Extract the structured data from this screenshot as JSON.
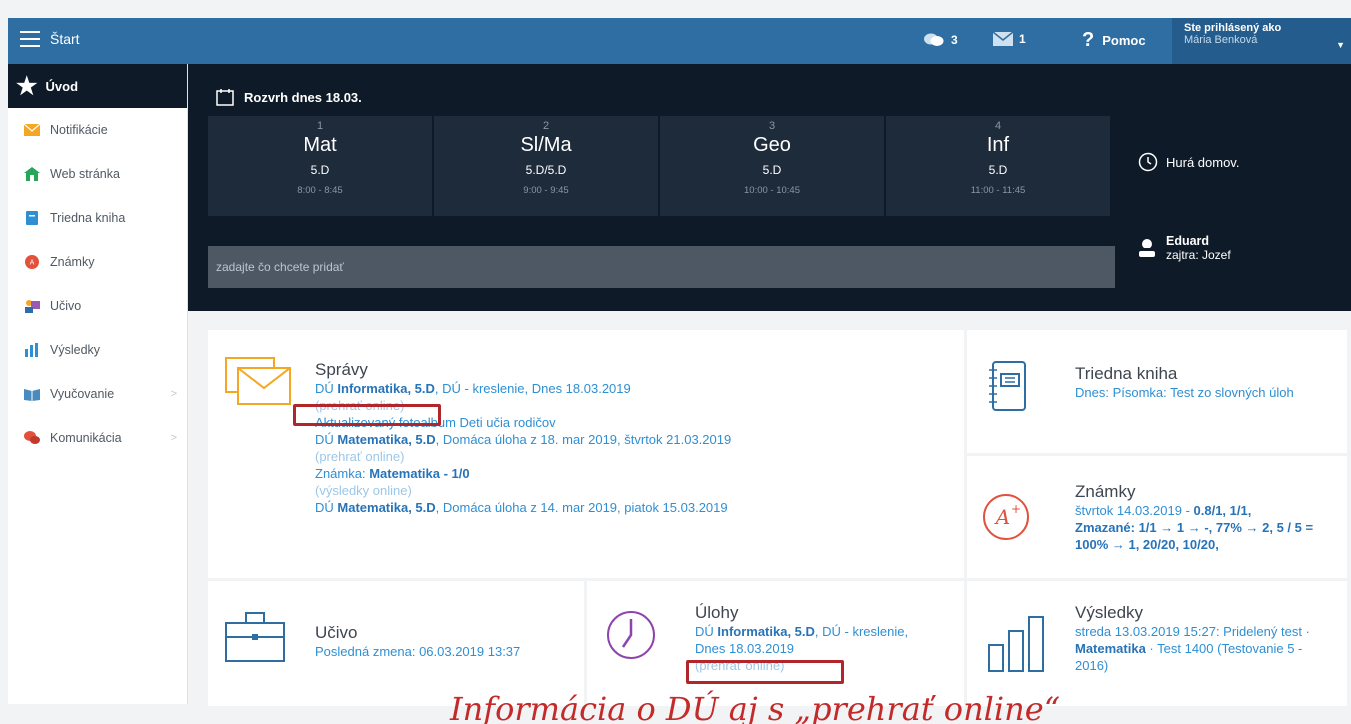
{
  "topbar": {
    "title": "Štart",
    "messages_count": "3",
    "mail_count": "1",
    "help_label": "Pomoc",
    "user_label": "Ste prihlásený ako",
    "user_name": "Mária Benková"
  },
  "sidebar": {
    "items": [
      {
        "label": "Úvod"
      },
      {
        "label": "Notifikácie"
      },
      {
        "label": "Web stránka"
      },
      {
        "label": "Triedna kniha"
      },
      {
        "label": "Známky"
      },
      {
        "label": "Učivo"
      },
      {
        "label": "Výsledky"
      },
      {
        "label": "Vyučovanie"
      },
      {
        "label": "Komunikácia"
      }
    ]
  },
  "schedule": {
    "title": "Rozvrh dnes 18.03.",
    "lessons": [
      {
        "num": "1",
        "subject": "Mat",
        "class": "5.D",
        "time": "8:00 - 8:45"
      },
      {
        "num": "2",
        "subject": "Sl/Ma",
        "class": "5.D/5.D",
        "time": "9:00 - 9:45"
      },
      {
        "num": "3",
        "subject": "Geo",
        "class": "5.D",
        "time": "10:00 - 10:45"
      },
      {
        "num": "4",
        "subject": "Inf",
        "class": "5.D",
        "time": "11:00 - 11:45"
      }
    ],
    "add_placeholder": "zadajte čo chcete pridať",
    "home_label": "Hurá domov.",
    "duty_name": "Eduard",
    "duty_tomorrow": "zajtra: Jozef"
  },
  "spravy": {
    "title": "Správy",
    "items": [
      {
        "a": "DÚ ",
        "b": "Informatika, 5.D",
        "c": ", DÚ - kreslenie, Dnes 18.03.2019",
        "sub": "(prehrať online)"
      },
      {
        "a": "Aktualizovaný fotoalbum Deti učia rodičov",
        "b": "",
        "c": "",
        "sub": ""
      },
      {
        "a": "DÚ ",
        "b": "Matematika, 5.D",
        "c": ", Domáca úloha z 18. mar 2019, štvrtok 21.03.2019",
        "sub": "(prehrať online)"
      },
      {
        "a": "Známka: ",
        "b": "Matematika - 1/0",
        "c": "",
        "sub": "(výsledky online)"
      },
      {
        "a": "DÚ ",
        "b": "Matematika, 5.D",
        "c": ", Domáca úloha z 14. mar 2019, piatok 15.03.2019",
        "sub": ""
      }
    ]
  },
  "triedna": {
    "title": "Triedna kniha",
    "text": "Dnes: Písomka: Test zo slovných úloh"
  },
  "znamky": {
    "title": "Známky",
    "line1a": "štvrtok 14.03.2019 - ",
    "line1b": "0.8/1, 1/1,",
    "line2": "Zmazané: 1/1 → 1 → -, 77% → 2, 5 / 5 = 100% → 1, 20/20, 10/20,"
  },
  "ucivo": {
    "title": "Učivo",
    "text": "Posledná zmena: 06.03.2019 13:37"
  },
  "ulohy": {
    "title": "Úlohy",
    "a": "DÚ ",
    "b": "Informatika, 5.D",
    "c": ", DÚ - kreslenie, Dnes 18.03.2019",
    "sub": "(prehrať online)"
  },
  "vysledky": {
    "title": "Výsledky",
    "a": "streda 13.03.2019 15:27: Pridelený test · ",
    "b": "Matematika",
    "c": " · Test 1400 (Testovanie 5 - 2016)"
  },
  "annotation": "Informácia o DÚ aj s „prehrať online“",
  "colors": {
    "topbar": "#2e6ea3",
    "dark": "#0e1a27",
    "link": "#2e8fd3",
    "annotation": "#c32b2b"
  }
}
